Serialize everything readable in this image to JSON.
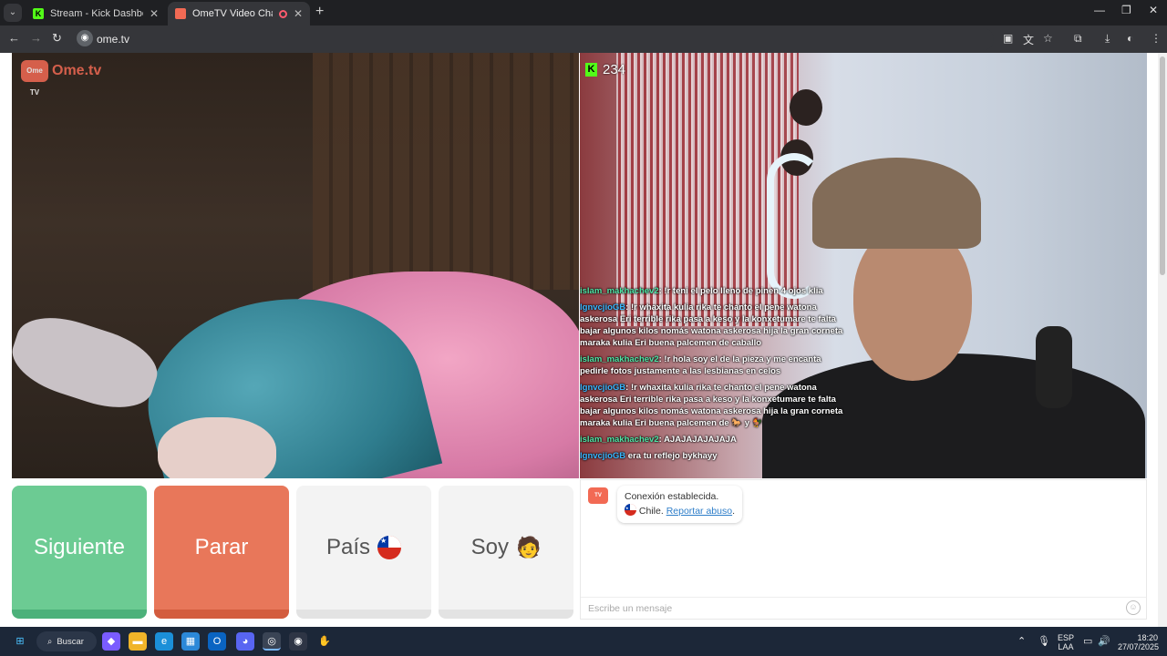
{
  "browser": {
    "tabs": [
      {
        "label": "Stream - Kick Dashboard",
        "favicon": "kick-icon"
      },
      {
        "label": "OmeTV Video Chat — Ome",
        "favicon": "ometv-icon",
        "recording": true
      }
    ],
    "url": "ome.tv"
  },
  "stream_overlay": {
    "viewer_count": "234",
    "messages": [
      {
        "user": "islam_makhachev2",
        "text": ": !r teni el pelo lleno de pinen 4 ojos klia"
      },
      {
        "user": "lgnvcjioGB",
        "text": ": !r whaxita kulia rika te chanto el pene watona askerosa Eri terrible rika pasa a keso y la konxetumare te falta bajar algunos kilos nomás watona askerosa hija la gran corneta maraka kulia Eri buena palcemen de caballo"
      },
      {
        "user": "islam_makhachev2",
        "text": ": !r hola soy el de la pieza y me encanta pedirle fotos justamente a las lesbianas en celos"
      },
      {
        "user": "lgnvcjioGB",
        "text": ": !r whaxita kulia rika te chanto el pene watona askerosa Eri terrible rika pasa a keso y la konxetumare te falta bajar algunos kilos nomás watona askerosa hija la gran corneta maraka kulia Eri buena palcemen de 🐎 y 🐓"
      },
      {
        "user": "islam_makhachev2",
        "text": ": AJAJAJAJAJAJA"
      },
      {
        "user": "lgnvcjioGB",
        "text": " era tu reflejo bykhayy"
      }
    ]
  },
  "logo": {
    "text": "Ome.tv",
    "badge": "Ome TV"
  },
  "controls": {
    "next_label": "Siguiente",
    "stop_label": "Parar",
    "country_label": "País",
    "me_label": "Soy"
  },
  "chat": {
    "system_line1": "Conexión establecida.",
    "country": "Chile.",
    "report_label": "Reportar abuso",
    "input_placeholder": "Escribe un mensaje"
  },
  "taskbar": {
    "search_label": "Buscar",
    "language": "ESP",
    "layout": "LAA",
    "time": "18:20",
    "date": "27/07/2025"
  },
  "colors": {
    "next": "#6ccb93",
    "stop": "#e8775a",
    "brand": "#f26a54",
    "kick": "#53fc18"
  }
}
